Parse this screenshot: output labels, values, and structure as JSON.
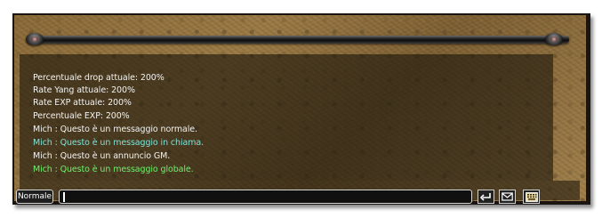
{
  "chat": {
    "messages": [
      {
        "text": "Percentuale drop attuale: 200%",
        "type": "system"
      },
      {
        "text": "Rate Yang attuale: 200%",
        "type": "system"
      },
      {
        "text": "Rate EXP attuale: 200%",
        "type": "system"
      },
      {
        "text": "Percentuale EXP: 200%",
        "type": "system"
      },
      {
        "text": "Mich : Questo è un messaggio normale.",
        "type": "normal"
      },
      {
        "text": "Mich : Questo è un messaggio in chiama.",
        "type": "shout"
      },
      {
        "text": " Mich : Questo è un annuncio GM.",
        "type": "gm"
      },
      {
        "text": "Mich : Questo è un messaggio globale.",
        "type": "global"
      }
    ]
  },
  "input_bar": {
    "mode_label": "Normale",
    "input_value": "",
    "icons": {
      "send": "return-arrow-icon",
      "mail": "envelope-icon",
      "keyboard": "keyboard-icon"
    }
  },
  "colors": {
    "system_text": "#f2f2f2",
    "shout_text": "#7fe2d8",
    "global_text": "#6cf06c",
    "panel_background": "#8a6a38"
  }
}
